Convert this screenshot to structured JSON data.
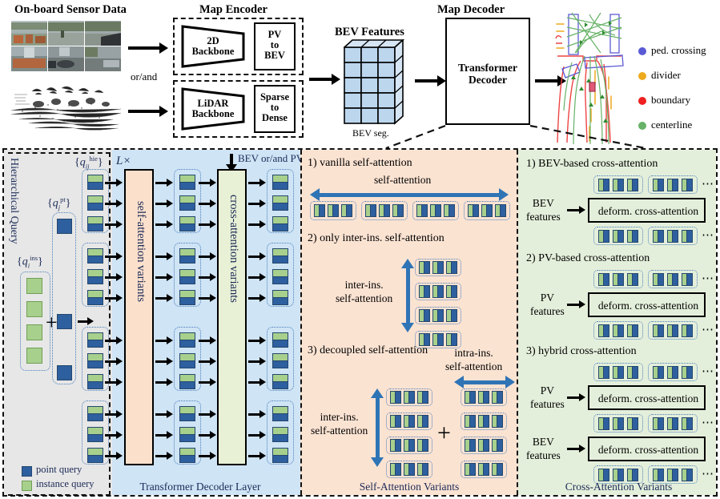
{
  "top": {
    "sensor_title": "On-board Sensor Data",
    "map_encoder_title": "Map Encoder",
    "bev_features_title": "BEV Features",
    "map_decoder_title": "Map Decoder",
    "or_and": "or/and",
    "backbone_2d": "2D\nBackbone",
    "pv_to_bev": "PV\nto\nBEV",
    "lidar_backbone": "LiDAR\nBackbone",
    "sparse_to_dense": "Sparse\nto\nDense",
    "transformer_decoder": "Transformer\nDecoder",
    "bev_seg": "BEV seg.",
    "legend": [
      {
        "label": "ped. crossing",
        "color": "#5a5ad6"
      },
      {
        "label": "divider",
        "color": "#edaa1e"
      },
      {
        "label": "boundary",
        "color": "#ee2020"
      },
      {
        "label": "centerline",
        "color": "#66b266"
      }
    ]
  },
  "decoder_panel": {
    "title": "Transformer Decoder Layer",
    "hierarchical_query": "Hierarchical Query",
    "q_ins": "{q_i^ins}",
    "q_pt": "{q_j^pt}",
    "q_hie": "{q_ij^hie}",
    "repeat": "L×",
    "self_attention_variants": "self-attention variants",
    "cross_attention_variants": "cross-attention variants",
    "bev_or_pv": "BEV or/and PV",
    "plus": "+",
    "legend": [
      {
        "label": "point query",
        "color": "#2e5f9e"
      },
      {
        "label": "instance query",
        "color": "#a8d08d"
      }
    ]
  },
  "self_attention_panel": {
    "title": "Self-Attention Variants",
    "bg": "#fbe3d2",
    "variants": [
      {
        "num": "1)",
        "name": "vanilla self-attention",
        "arrow_label": "self-attention"
      },
      {
        "num": "2)",
        "name": "only inter-ins. self-attention",
        "arrow_label": "inter-ins.\nself-attention"
      },
      {
        "num": "3)",
        "name": "decoupled self-attention",
        "arrow_label_left": "inter-ins.\nself-attention",
        "arrow_label_right": "intra-ins.\nself-attention",
        "plus": "+"
      }
    ]
  },
  "cross_attention_panel": {
    "title": "Cross-Attention Variants",
    "bg": "#e4efdb",
    "deform_label": "deform. cross-attention",
    "ellipsis": "⋯",
    "variants": [
      {
        "num": "1)",
        "name": "BEV-based cross-attention",
        "sources": [
          "BEV\nfeatures"
        ]
      },
      {
        "num": "2)",
        "name": "PV-based cross-attention",
        "sources": [
          "PV\nfeatures"
        ]
      },
      {
        "num": "3)",
        "name": "hybrid cross-attention",
        "sources": [
          "PV\nfeatures",
          "BEV\nfeatures"
        ]
      }
    ]
  },
  "colors": {
    "panel_decoder_bg": "#cfe4f5",
    "panel_query_bg": "#e7e7e7",
    "self_attn_box": "#fbe0cc",
    "cross_attn_box": "#e8f0d5",
    "point_query": "#2e5f9e",
    "instance_query": "#a8d08d",
    "bev_cube": "#bcd6ee",
    "arrow_blue": "#2f74b5"
  }
}
